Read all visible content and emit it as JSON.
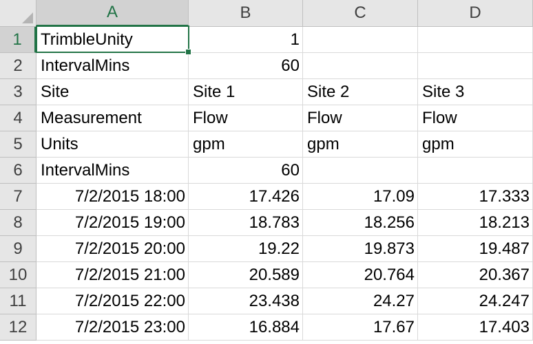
{
  "columns": [
    "A",
    "B",
    "C",
    "D"
  ],
  "active_column": "A",
  "active_row": "1",
  "rows": [
    {
      "num": "1",
      "cells": [
        "TrimbleUnity",
        "1",
        "",
        ""
      ]
    },
    {
      "num": "2",
      "cells": [
        "IntervalMins",
        "60",
        "",
        ""
      ]
    },
    {
      "num": "3",
      "cells": [
        "Site",
        "Site 1",
        "Site 2",
        "Site 3"
      ]
    },
    {
      "num": "4",
      "cells": [
        "Measurement",
        "Flow",
        "Flow",
        "Flow"
      ]
    },
    {
      "num": "5",
      "cells": [
        "Units",
        "gpm",
        "gpm",
        "gpm"
      ]
    },
    {
      "num": "6",
      "cells": [
        "IntervalMins",
        "60",
        "",
        ""
      ]
    },
    {
      "num": "7",
      "cells": [
        "7/2/2015 18:00",
        "17.426",
        "17.09",
        "17.333"
      ]
    },
    {
      "num": "8",
      "cells": [
        "7/2/2015 19:00",
        "18.783",
        "18.256",
        "18.213"
      ]
    },
    {
      "num": "9",
      "cells": [
        "7/2/2015 20:00",
        "19.22",
        "19.873",
        "19.487"
      ]
    },
    {
      "num": "10",
      "cells": [
        "7/2/2015 21:00",
        "20.589",
        "20.764",
        "20.367"
      ]
    },
    {
      "num": "11",
      "cells": [
        "7/2/2015 22:00",
        "23.438",
        "24.27",
        "24.247"
      ]
    },
    {
      "num": "12",
      "cells": [
        "7/2/2015 23:00",
        "16.884",
        "17.67",
        "17.403"
      ]
    }
  ],
  "colors": {
    "selection": "#217346",
    "header_bg": "#e6e6e6",
    "gridline": "#d9d9d9"
  }
}
